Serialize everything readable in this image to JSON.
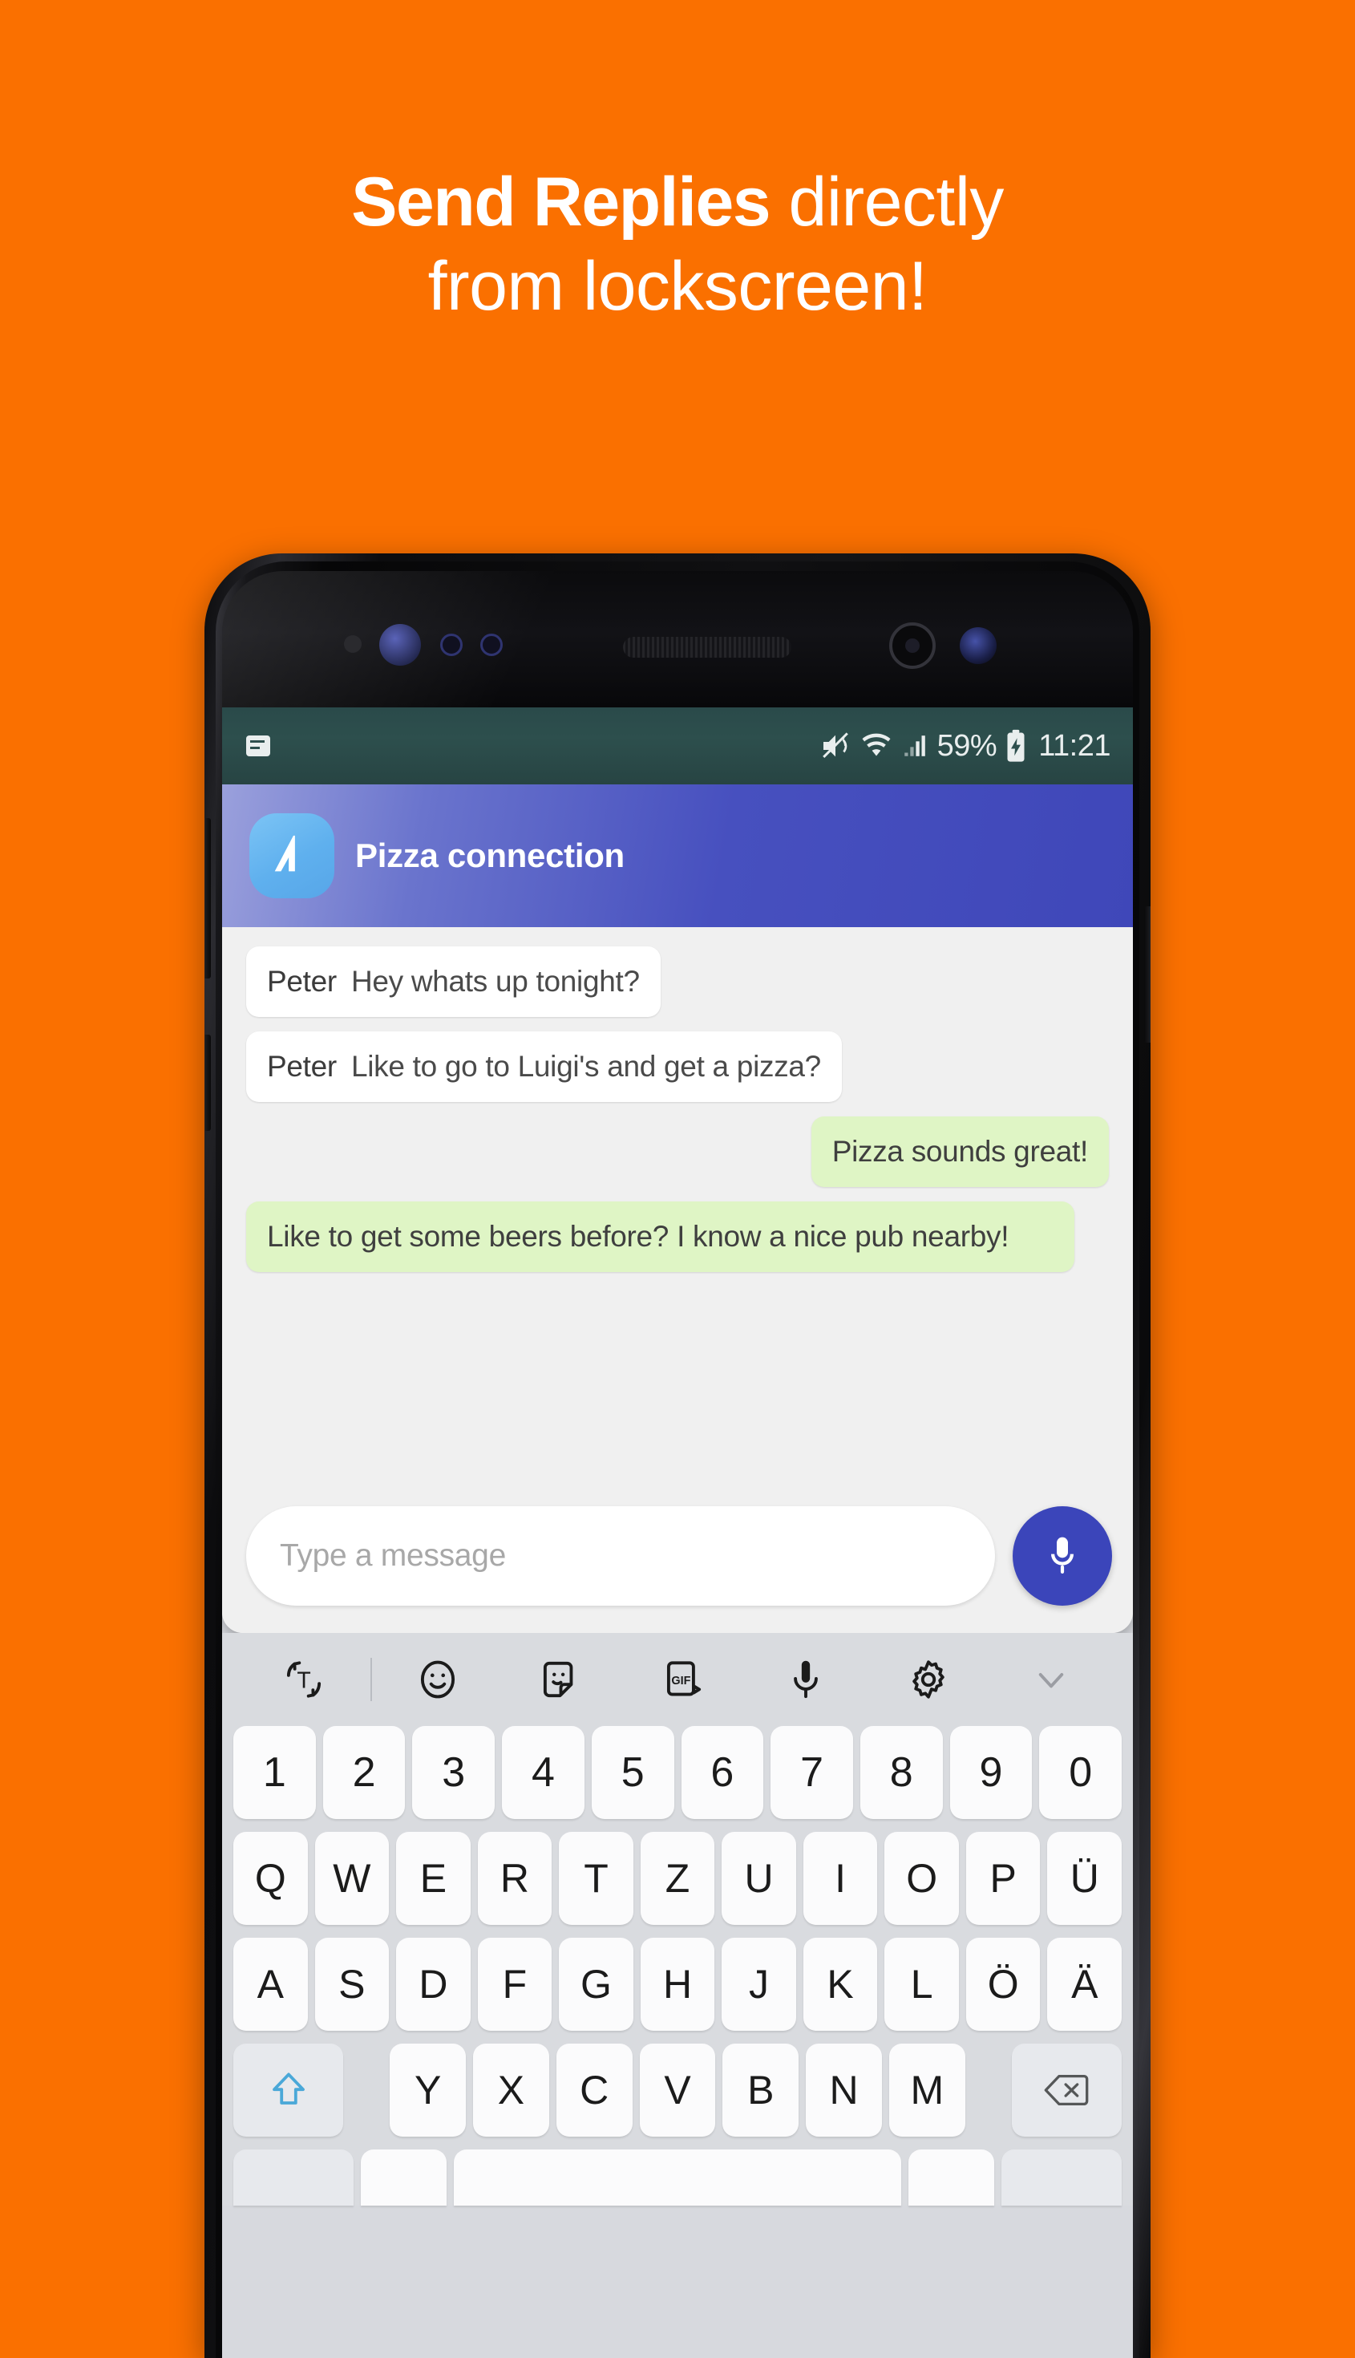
{
  "theme": {
    "background": "#fa7000",
    "accent_blue": "#3b45ba",
    "bubble_in": "#ffffff",
    "bubble_out": "#dff5c5",
    "avatar_blue": "#5fb0ee"
  },
  "headline": {
    "line1_bold": "Send Replies",
    "line1_rest": " directly",
    "line2": "from lockscreen!"
  },
  "phone": {
    "status_bar": {
      "notification_icon": "message-note-icon",
      "mute_icon": "mute-vibrate-icon",
      "wifi_icon": "wifi-icon",
      "signal_icon": "signal-bars-icon",
      "battery_percent": "59%",
      "battery_icon": "battery-charging-icon",
      "time": "11:21"
    },
    "notification": {
      "app_icon": "app-logo-icon",
      "title": "Pizza connection",
      "messages": [
        {
          "direction": "in",
          "sender": "Peter",
          "text": "Hey whats up tonight?"
        },
        {
          "direction": "in",
          "sender": "Peter",
          "text": "Like to go to Luigi's and get a pizza?"
        },
        {
          "direction": "out",
          "sender": "",
          "text": "Pizza sounds great!",
          "align": "right"
        },
        {
          "direction": "out",
          "sender": "",
          "text": "Like to get some beers before? I know a nice pub nearby!",
          "align": "wide"
        }
      ],
      "composer": {
        "placeholder": "Type a message",
        "mic_button": "microphone-icon"
      }
    },
    "keyboard": {
      "toolbar": [
        {
          "name": "translate-icon"
        },
        {
          "name": "emoji-icon"
        },
        {
          "name": "sticker-icon"
        },
        {
          "name": "gif-icon",
          "label": "GIF"
        },
        {
          "name": "microphone-icon"
        },
        {
          "name": "settings-gear-icon"
        },
        {
          "name": "chevron-down-icon"
        }
      ],
      "row_numbers": [
        "1",
        "2",
        "3",
        "4",
        "5",
        "6",
        "7",
        "8",
        "9",
        "0"
      ],
      "row_top": [
        "Q",
        "W",
        "E",
        "R",
        "T",
        "Z",
        "U",
        "I",
        "O",
        "P",
        "Ü"
      ],
      "row_home": [
        "A",
        "S",
        "D",
        "F",
        "G",
        "H",
        "J",
        "K",
        "L",
        "Ö",
        "Ä"
      ],
      "row_bottom": [
        "Y",
        "X",
        "C",
        "V",
        "B",
        "N",
        "M"
      ],
      "shift_key": "shift-arrow-icon",
      "backspace_key": "backspace-icon",
      "row_space": [
        {
          "name": "symbols-key",
          "label": ""
        },
        {
          "name": "comma-key",
          "label": ""
        },
        {
          "name": "space-key",
          "label": ""
        },
        {
          "name": "period-key",
          "label": ""
        },
        {
          "name": "enter-key",
          "label": ""
        }
      ]
    }
  }
}
